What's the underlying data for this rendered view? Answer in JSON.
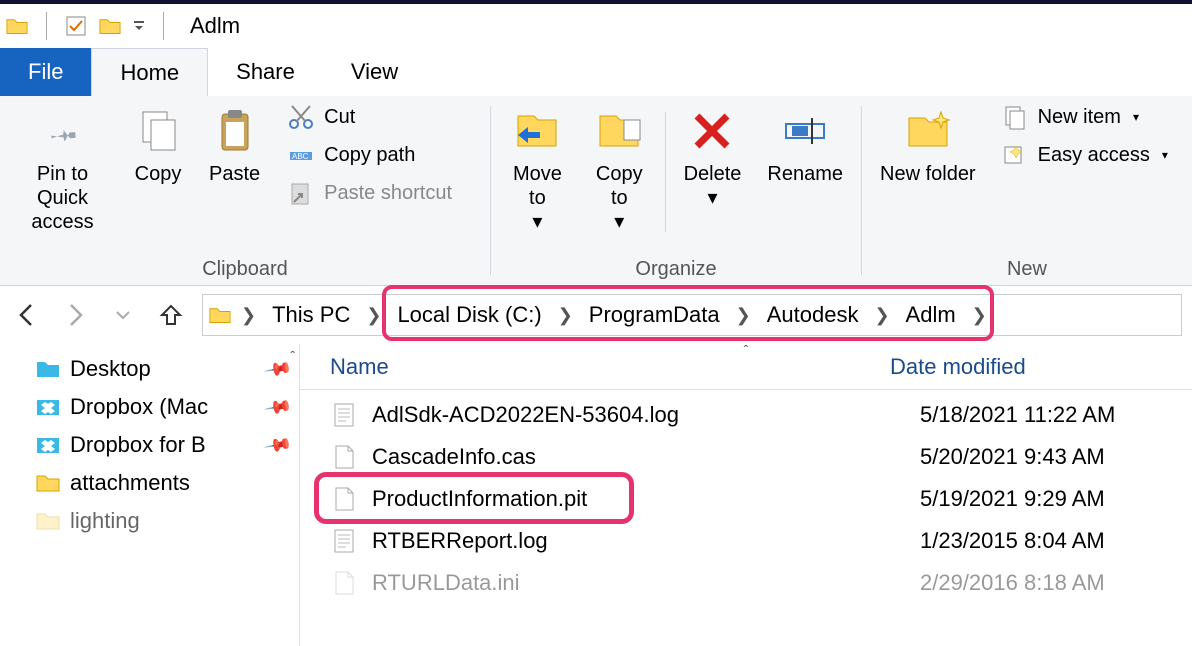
{
  "titlebar": {
    "title": "Adlm"
  },
  "ribbon": {
    "tabs": {
      "file": "File",
      "home": "Home",
      "share": "Share",
      "view": "View"
    },
    "clipboard": {
      "label": "Clipboard",
      "pin": "Pin to Quick access",
      "copy": "Copy",
      "paste": "Paste",
      "cut": "Cut",
      "copypath": "Copy path",
      "pasteshortcut": "Paste shortcut"
    },
    "organize": {
      "label": "Organize",
      "moveto": "Move to",
      "copyto": "Copy to",
      "delete": "Delete",
      "rename": "Rename"
    },
    "new": {
      "label": "New",
      "newfolder": "New folder",
      "newitem": "New item",
      "easyaccess": "Easy access"
    }
  },
  "breadcrumb": {
    "items": [
      "This PC",
      "Local Disk (C:)",
      "ProgramData",
      "Autodesk",
      "Adlm"
    ]
  },
  "sidebar": {
    "items": [
      {
        "label": "Desktop",
        "pinned": true,
        "icon": "folder-blue"
      },
      {
        "label": "Dropbox (Mac",
        "pinned": true,
        "icon": "dropbox"
      },
      {
        "label": "Dropbox for B",
        "pinned": true,
        "icon": "dropbox"
      },
      {
        "label": "attachments",
        "pinned": false,
        "icon": "folder"
      },
      {
        "label": "lighting",
        "pinned": false,
        "icon": "folder"
      }
    ]
  },
  "columns": {
    "name": "Name",
    "date": "Date modified"
  },
  "files": [
    {
      "name": "AdlSdk-ACD2022EN-53604.log",
      "date": "5/18/2021 11:22 AM",
      "icon": "text"
    },
    {
      "name": "CascadeInfo.cas",
      "date": "5/20/2021 9:43 AM",
      "icon": "blank"
    },
    {
      "name": "ProductInformation.pit",
      "date": "5/19/2021 9:29 AM",
      "icon": "blank"
    },
    {
      "name": "RTBERReport.log",
      "date": "1/23/2015 8:04 AM",
      "icon": "text"
    },
    {
      "name": "RTURLData.ini",
      "date": "2/29/2016 8:18 AM",
      "icon": "blank"
    }
  ]
}
